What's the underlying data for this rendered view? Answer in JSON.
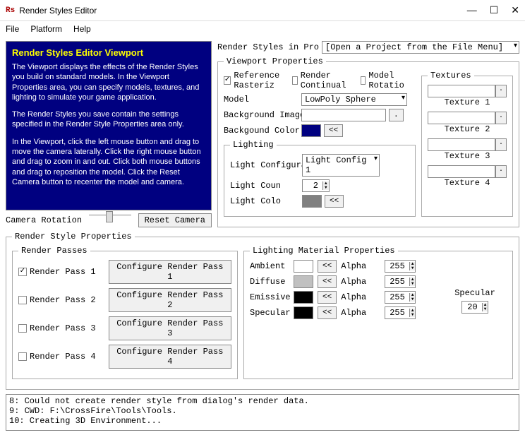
{
  "window": {
    "title": "Render Styles Editor",
    "icon": "Rs"
  },
  "menu": {
    "file": "File",
    "platform": "Platform",
    "help": "Help"
  },
  "viewport": {
    "title": "Render Styles Editor Viewport",
    "p1": "The Viewport displays the effects of the Render Styles you build on standard models. In the Viewport Properties area, you can specify models, textures, and lighting to simulate your game application.",
    "p2": "The Render Styles you save contain the settings specified in the Render Style Properties area only.",
    "p3": "In the Viewport, click the left mouse button and drag to move the camera laterally. Click the right mouse button and drag to zoom in and out. Click both mouse buttons and drag to reposition the model. Click the Reset Camera button to recenter the model and camera."
  },
  "camera": {
    "rotation_label": "Camera Rotation",
    "reset_btn": "Reset Camera"
  },
  "project": {
    "label": "Render Styles in Pro",
    "combo": "[Open a Project from the File Menu]"
  },
  "vp_props": {
    "legend": "Viewport Properties",
    "ref_raster": "Reference Rasteriz",
    "render_cont": "Render Continual",
    "model_rot": "Model Rotatio",
    "model_label": "Model",
    "model_value": "LowPoly Sphere",
    "bg_img_label": "Background Image",
    "bg_color_label": "Backgound Color",
    "bg_color": "#000080"
  },
  "lighting": {
    "legend": "Lighting",
    "config_label": "Light Configurat",
    "config_value": "Light Config 1",
    "count_label": "Light Coun",
    "count_value": "2",
    "color_label": "Light Colo",
    "color": "#808080"
  },
  "textures": {
    "legend": "Textures",
    "t1": "Texture 1",
    "t2": "Texture 2",
    "t3": "Texture 3",
    "t4": "Texture 4"
  },
  "rsp": {
    "legend": "Render Style Properties",
    "passes_legend": "Render Passes",
    "p1_label": "Render Pass 1",
    "p1_btn": "Configure Render Pass 1",
    "p2_label": "Render Pass 2",
    "p2_btn": "Configure Render Pass 2",
    "p3_label": "Render Pass 3",
    "p3_btn": "Configure Render Pass 3",
    "p4_label": "Render Pass 4",
    "p4_btn": "Configure Render Pass 4"
  },
  "lmp": {
    "legend": "Lighting Material Properties",
    "ambient": "Ambient",
    "diffuse": "Diffuse",
    "emissive": "Emissive",
    "specular": "Specular",
    "alpha": "Alpha",
    "alpha_val": "255",
    "ambient_color": "#ffffff",
    "diffuse_color": "#c0c0c0",
    "emissive_color": "#000000",
    "specular_color": "#000000",
    "spec_label": "Specular",
    "spec_val": "20"
  },
  "log": "8: Could not create render style from dialog's render data.\n9: CWD: F:\\CrossFire\\Tools\\Tools.\n10: Creating 3D Environment..."
}
